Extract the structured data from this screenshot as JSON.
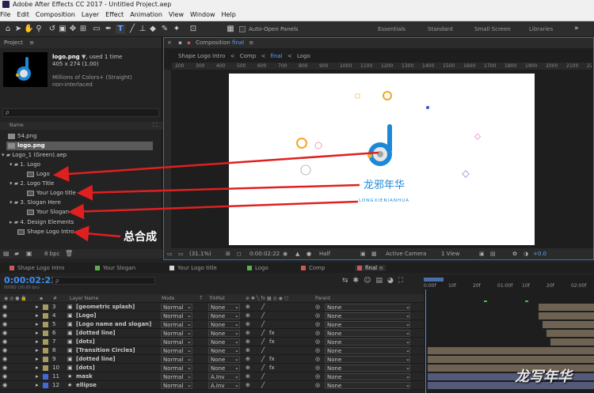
{
  "window": {
    "title": "Adobe After Effects CC 2017 - Untitled Project.aep"
  },
  "menu": [
    "File",
    "Edit",
    "Composition",
    "Layer",
    "Effect",
    "Animation",
    "View",
    "Window",
    "Help"
  ],
  "toolbar": {
    "auto_open": "Auto-Open Panels",
    "workspaces": [
      "Essentials",
      "Standard",
      "Small Screen",
      "Libraries"
    ],
    "more": "»"
  },
  "project": {
    "panel_title": "Project",
    "menu": "≡",
    "selected_name": "logo.png",
    "used": ", used 1 time",
    "dims": "405 x 274 (1.00)",
    "colors": "Millions of Colors+ (Straight)",
    "interlace": "non-interlaced",
    "search_icon": "ρ",
    "col_name": "Name",
    "bpc": "8 bpc",
    "items": [
      "54.png",
      "logo.png",
      "Logo_1 (Green).aep",
      "1. Logo",
      "Logo",
      "2. Logo Title",
      "Your Logo title",
      "3. Slogan Here",
      "Your Slogan",
      "4. Design Elements",
      "Shape Logo Intro"
    ]
  },
  "annotation": "总合成",
  "comp": {
    "panel_prefix": "Composition",
    "name": "final",
    "breadcrumbs": [
      "Shape Logo Intro",
      "Comp",
      "final",
      "Logo"
    ],
    "ruler": [
      "200",
      "300",
      "400",
      "500",
      "600",
      "700",
      "800",
      "900",
      "1000",
      "1100",
      "1200",
      "1300",
      "1400",
      "1500",
      "1600",
      "1700",
      "1800",
      "1900",
      "2000",
      "2100",
      "2200"
    ],
    "zoom": "(31.1%)",
    "timecode": "0:00:02:22",
    "quality": "Half",
    "camera": "Active Camera",
    "view": "1 View",
    "offset": "+0.0"
  },
  "logo": {
    "cn": "龙邪年华",
    "en": "LONGXIENIANHUA",
    "colors": {
      "accent": "#1e88d8",
      "orange": "#f5a623"
    }
  },
  "timeline": {
    "tabs": [
      "Shape Logo Intro",
      "Your Slogan",
      "Your Logo title",
      "Logo",
      "Comp",
      "final"
    ],
    "tab_colors": [
      "#c85a5a",
      "#5ab04a",
      "#d8d8d8",
      "#5ab04a",
      "#c85a5a",
      "#c85a5a"
    ],
    "timecode": "0:00:02:22",
    "frames": "00082 (30.00 fps)",
    "search": "ρ",
    "headers": {
      "num": "#",
      "layer": "Layer Name",
      "mode": "Mode",
      "t": "T",
      "trkmat": "TrkMat",
      "parent": "Parent"
    },
    "ruler": [
      "0:00f",
      "10f",
      "20f",
      "01:00f",
      "10f",
      "20f",
      "02:00f",
      "10f"
    ],
    "layers": [
      {
        "n": "3",
        "name": "[geometric splash]",
        "mode": "Normal",
        "trk": "None",
        "parent": "None",
        "color": "#a89a63",
        "fx": false
      },
      {
        "n": "4",
        "name": "[Logo]",
        "mode": "Normal",
        "trk": "None",
        "parent": "None",
        "color": "#a89a63",
        "fx": false
      },
      {
        "n": "5",
        "name": "[Logo name and slogan]",
        "mode": "Normal",
        "trk": "None",
        "parent": "None",
        "color": "#a89a63",
        "fx": false
      },
      {
        "n": "6",
        "name": "[dotted line]",
        "mode": "Normal",
        "trk": "None",
        "parent": "None",
        "color": "#a89a63",
        "fx": true
      },
      {
        "n": "7",
        "name": "[dots]",
        "mode": "Normal",
        "trk": "None",
        "parent": "None",
        "color": "#a89a63",
        "fx": true
      },
      {
        "n": "8",
        "name": "[Transition Circles]",
        "mode": "Normal",
        "trk": "None",
        "parent": "None",
        "color": "#a89a63",
        "fx": false
      },
      {
        "n": "9",
        "name": "[dotted line]",
        "mode": "Normal",
        "trk": "None",
        "parent": "None",
        "color": "#a89a63",
        "fx": true
      },
      {
        "n": "10",
        "name": "[dots]",
        "mode": "Normal",
        "trk": "None",
        "parent": "None",
        "color": "#a89a63",
        "fx": true
      },
      {
        "n": "11",
        "name": "mask",
        "mode": "Normal",
        "trk": "A.Inv",
        "parent": "None",
        "color": "#3f6ad8",
        "fx": false
      },
      {
        "n": "12",
        "name": "ellipse",
        "mode": "Normal",
        "trk": "A.Inv",
        "parent": "None",
        "color": "#3f6ad8",
        "fx": false
      }
    ]
  },
  "watermark": "龙写年华"
}
